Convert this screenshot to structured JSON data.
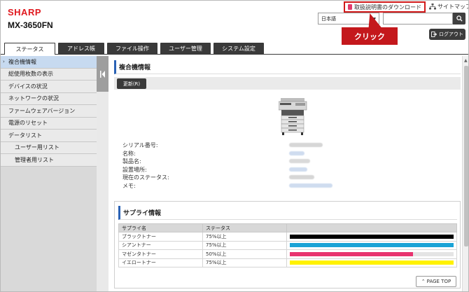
{
  "header": {
    "brand": "SHARP",
    "model": "MX-3650FN",
    "manual_link": "取扱説明書のダウンロード",
    "sitemap": "サイトマップ",
    "language": "日本語",
    "search_value": "",
    "logout": "ログアウト",
    "callout": "クリック"
  },
  "tabs": [
    {
      "label": "ステータス",
      "active": true
    },
    {
      "label": "アドレス帳",
      "active": false
    },
    {
      "label": "ファイル操作",
      "active": false
    },
    {
      "label": "ユーザー管理",
      "active": false
    },
    {
      "label": "システム設定",
      "active": false
    }
  ],
  "sidebar": {
    "items": [
      {
        "label": "複合機情報",
        "active": true
      },
      {
        "label": "総使用枚数の表示"
      },
      {
        "label": "デバイスの状況"
      },
      {
        "label": "ネットワークの状況"
      },
      {
        "label": "ファームウェアバージョン"
      },
      {
        "label": "電源のリセット"
      },
      {
        "label": "データリスト"
      },
      {
        "label": "ユーザー用リスト",
        "sub": true
      },
      {
        "label": "管理者用リスト",
        "sub": true
      }
    ]
  },
  "main": {
    "title": "複合機情報",
    "refresh": "更新(R)",
    "info_labels": [
      "シリアル番号:",
      "名称:",
      "製品名:",
      "設置場所:",
      "現在のステータス:",
      "メモ:"
    ],
    "supply": {
      "title": "サプライ情報",
      "col_name": "サプライ名",
      "col_status": "ステータス",
      "rows": [
        {
          "name": "ブラックトナー",
          "status": "75%以上",
          "level": 1.0,
          "color": "#000000"
        },
        {
          "name": "シアントナー",
          "status": "75%以上",
          "level": 1.0,
          "color": "#1aa3d6"
        },
        {
          "name": "マゼンタトナー",
          "status": "50%以上",
          "level": 0.75,
          "color": "#e8336f"
        },
        {
          "name": "イエロートナー",
          "status": "75%以上",
          "level": 1.0,
          "color": "#fff200"
        }
      ]
    },
    "page_top": "PAGE TOP"
  }
}
